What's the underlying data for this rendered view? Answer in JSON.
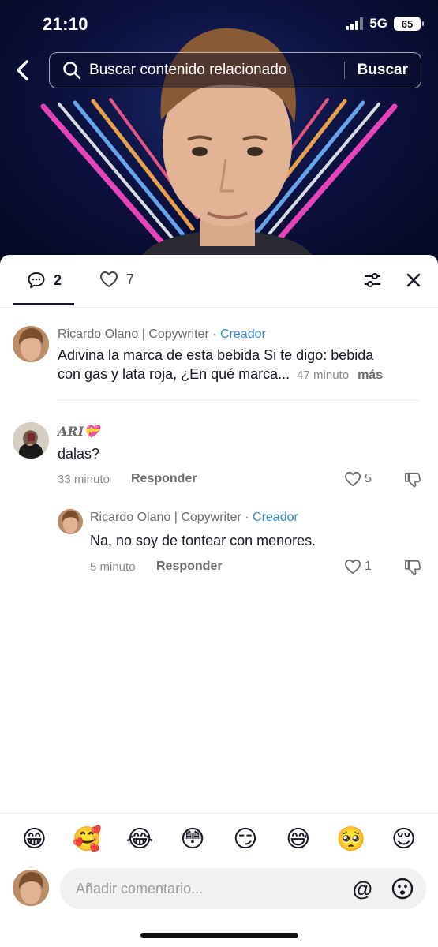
{
  "status_bar": {
    "time": "21:10",
    "network": "5G",
    "battery": "65"
  },
  "search": {
    "placeholder": "Buscar contenido relacionado",
    "submit_label": "Buscar"
  },
  "tabs": {
    "comments_count": "2",
    "likes_count": "7"
  },
  "comments": [
    {
      "author": "Ricardo Olano | Copywriter",
      "badge": "· Creador",
      "text_line1": "Adivina la marca de esta bebida Si te digo: bebida",
      "text_line2": "con gas y lata roja, ¿En qué marca...",
      "time": "47 minuto",
      "more_label": "más"
    },
    {
      "author": "ARI💝",
      "text": "dalas?",
      "time": "33 minuto",
      "reply_label": "Responder",
      "likes": "5"
    },
    {
      "author": "Ricardo Olano | Copywriter",
      "badge": "· Creador",
      "text": "Na, no soy de tontear con menores.",
      "time": "5 minuto",
      "reply_label": "Responder",
      "likes": "1"
    }
  ],
  "emoji_bar": [
    "😁",
    "🥰",
    "😂",
    "😳",
    "😏",
    "😅",
    "🥺",
    "😌"
  ],
  "composer": {
    "placeholder": "Añadir comentario...",
    "mention_symbol": "@"
  },
  "icons": [
    "back-icon",
    "search-icon",
    "comment-icon",
    "heart-icon",
    "filter-icon",
    "close-icon",
    "dislike-icon",
    "emoji-icon"
  ]
}
